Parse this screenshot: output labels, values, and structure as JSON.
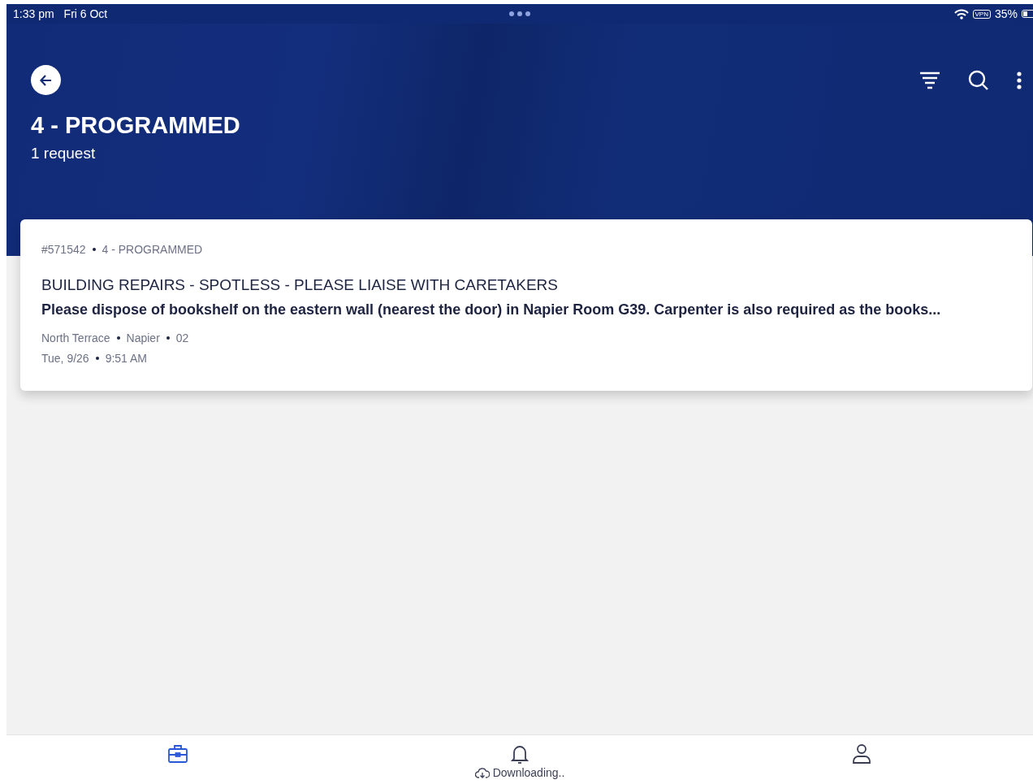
{
  "status_bar": {
    "time": "1:33 pm",
    "date": "Fri 6 Oct",
    "vpn": "VPN",
    "battery": "35%"
  },
  "header": {
    "title": "4 - PROGRAMMED",
    "subtitle": "1 request"
  },
  "requests": [
    {
      "number": "#571542",
      "status": "4 - PROGRAMMED",
      "title": "BUILDING REPAIRS - SPOTLESS - PLEASE LIAISE WITH CARETAKERS",
      "description": "Please dispose of bookshelf on the eastern wall (nearest the door) in Napier Room G39. Carpenter is also required as the books...",
      "location": [
        "North Terrace",
        "Napier",
        "02"
      ],
      "date": [
        "Tue, 9/26",
        "9:51 AM"
      ]
    }
  ],
  "bottom_nav": [
    {
      "kind": "work",
      "selected": true
    },
    {
      "kind": "notifications",
      "selected": false,
      "caption": "Downloading.."
    },
    {
      "kind": "profile",
      "selected": false
    }
  ]
}
